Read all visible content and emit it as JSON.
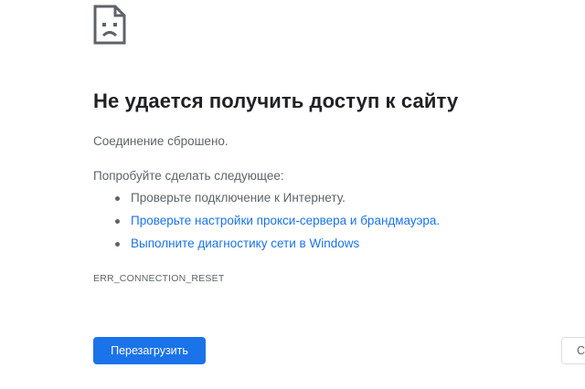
{
  "error": {
    "icon": "sad-page-icon",
    "title": "Не удается получить доступ к сайту",
    "subtitle": "Соединение сброшено.",
    "try_label": "Попробуйте сделать следующее:",
    "suggestions": [
      {
        "text": "Проверьте подключение к Интернету.",
        "link": false
      },
      {
        "text": "Проверьте настройки прокси-сервера и брандмауэра.",
        "link": true
      },
      {
        "text": "Выполните диагностику сети в Windows",
        "link": true
      }
    ],
    "code": "ERR_CONNECTION_RESET"
  },
  "buttons": {
    "reload_label": "Перезагрузить",
    "details_label": "С"
  },
  "colors": {
    "accent": "#1a73e8",
    "text_primary": "#202124",
    "text_secondary": "#5f6368"
  }
}
